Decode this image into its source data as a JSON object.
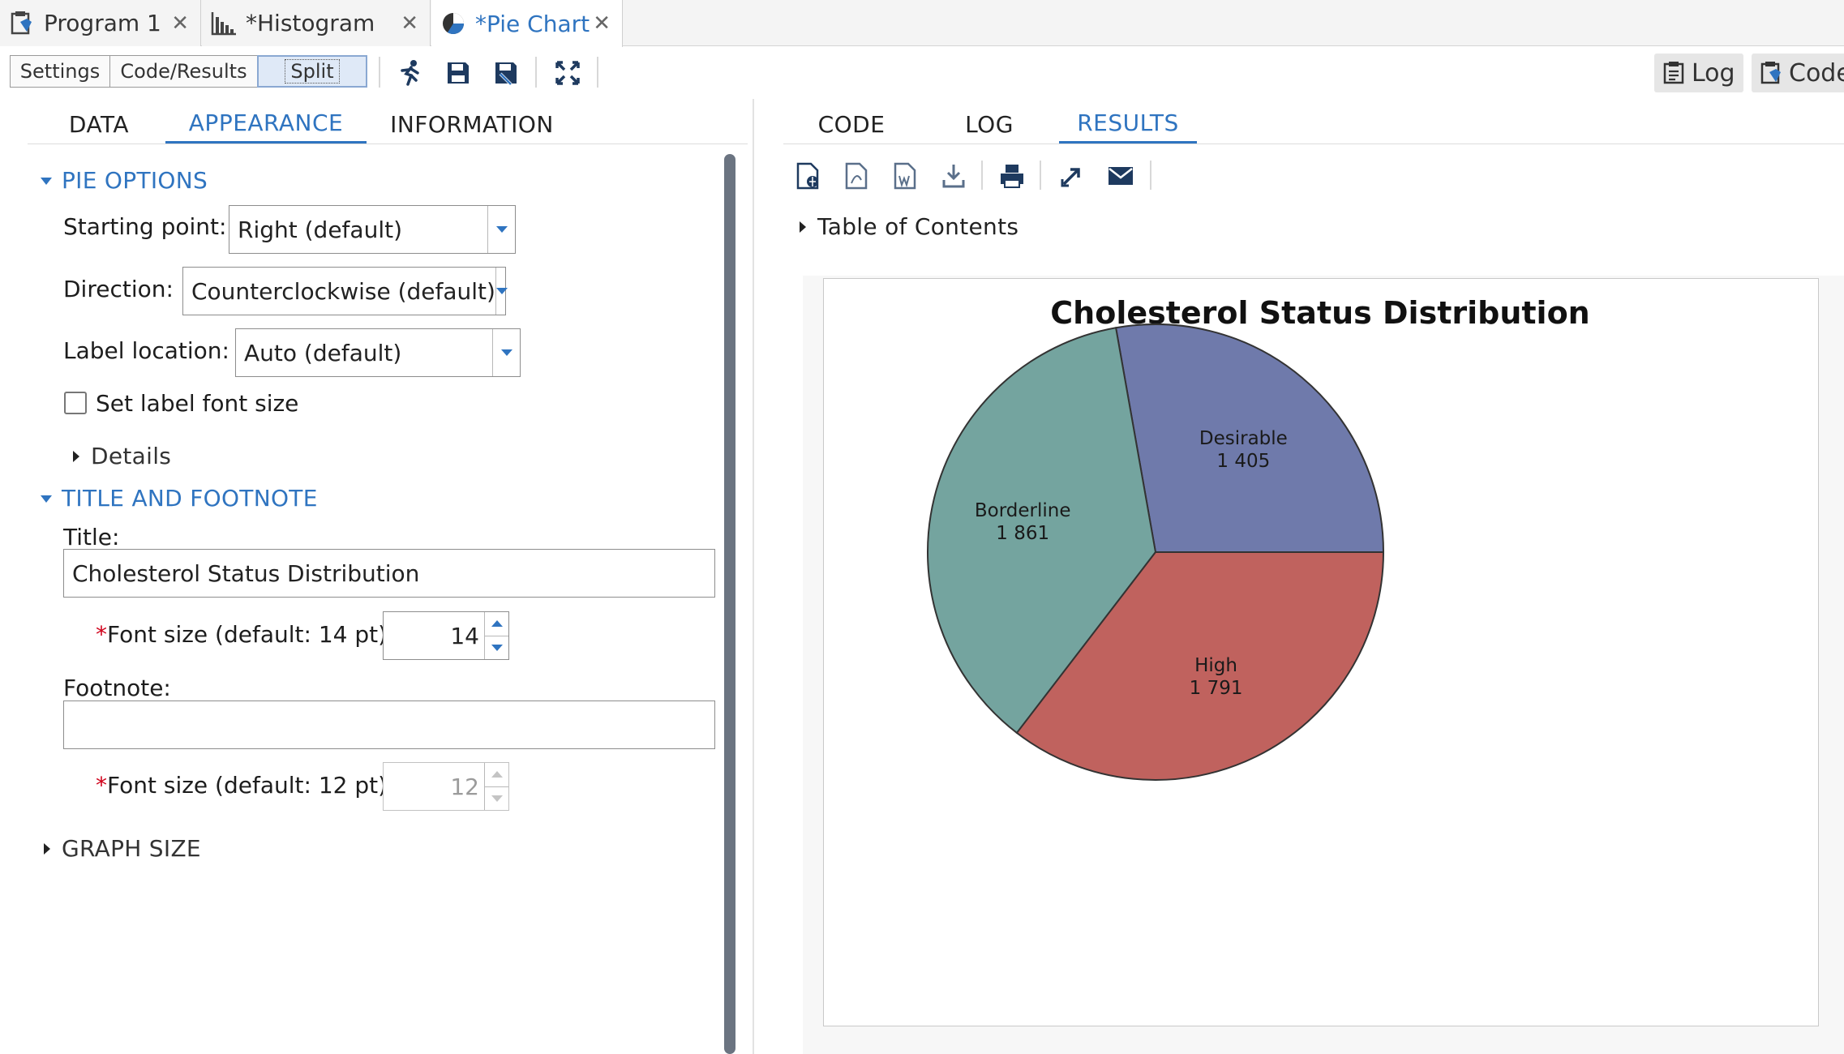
{
  "tabs": [
    {
      "label": "Program 1",
      "icon": "program-icon",
      "active": false
    },
    {
      "label": "*Histogram",
      "icon": "histogram-icon",
      "active": false
    },
    {
      "label": "*Pie Chart",
      "icon": "pie-chart-icon",
      "active": true
    }
  ],
  "toolbar": {
    "view_modes": [
      "Settings",
      "Code/Results",
      "Split"
    ],
    "selected_view": "Split",
    "icons": [
      "run-icon",
      "save-icon",
      "save-as-icon",
      "maximize-icon"
    ],
    "log_label": "Log",
    "code_label": "Code"
  },
  "left_panel": {
    "tabs": [
      "DATA",
      "APPEARANCE",
      "INFORMATION"
    ],
    "active_tab": "APPEARANCE",
    "pie_options": {
      "header": "PIE OPTIONS",
      "starting_point_label": "Starting point:",
      "starting_point_value": "Right (default)",
      "direction_label": "Direction:",
      "direction_value": "Counterclockwise (default)",
      "label_location_label": "Label location:",
      "label_location_value": "Auto (default)",
      "set_label_font_size_label": "Set label font size",
      "set_label_font_size_checked": false,
      "details_label": "Details"
    },
    "title_footnote": {
      "header": "TITLE AND FOOTNOTE",
      "title_label": "Title:",
      "title_value": "Cholesterol Status Distribution",
      "title_font_size_label": "Font size (default: 14 pt):",
      "title_font_size_value": "14",
      "footnote_label": "Footnote:",
      "footnote_value": "",
      "footnote_font_size_label": "Font size (default: 12 pt):",
      "footnote_font_size_value": "12",
      "required_mark": "*"
    },
    "graph_size_header": "GRAPH SIZE"
  },
  "right_panel": {
    "tabs": [
      "CODE",
      "LOG",
      "RESULTS"
    ],
    "active_tab": "RESULTS",
    "result_icons": [
      "open-in-browser-icon",
      "pdf-icon",
      "word-icon",
      "download-icon",
      "print-icon",
      "new-window-icon",
      "email-icon"
    ],
    "toc_label": "Table of Contents"
  },
  "chart_data": {
    "type": "pie",
    "title": "Cholesterol Status Distribution",
    "slices": [
      {
        "name": "Desirable",
        "value": 1405,
        "display": "1 405",
        "color": "#6f7aab"
      },
      {
        "name": "Borderline",
        "value": 1861,
        "display": "1 861",
        "color": "#74a49f"
      },
      {
        "name": "High",
        "value": 1791,
        "display": "1 791",
        "color": "#c0625e"
      }
    ],
    "start": "right",
    "direction": "counterclockwise",
    "outline_color": "#333333"
  },
  "colors": {
    "accent": "#2f74c0",
    "required": "#d0021b"
  }
}
